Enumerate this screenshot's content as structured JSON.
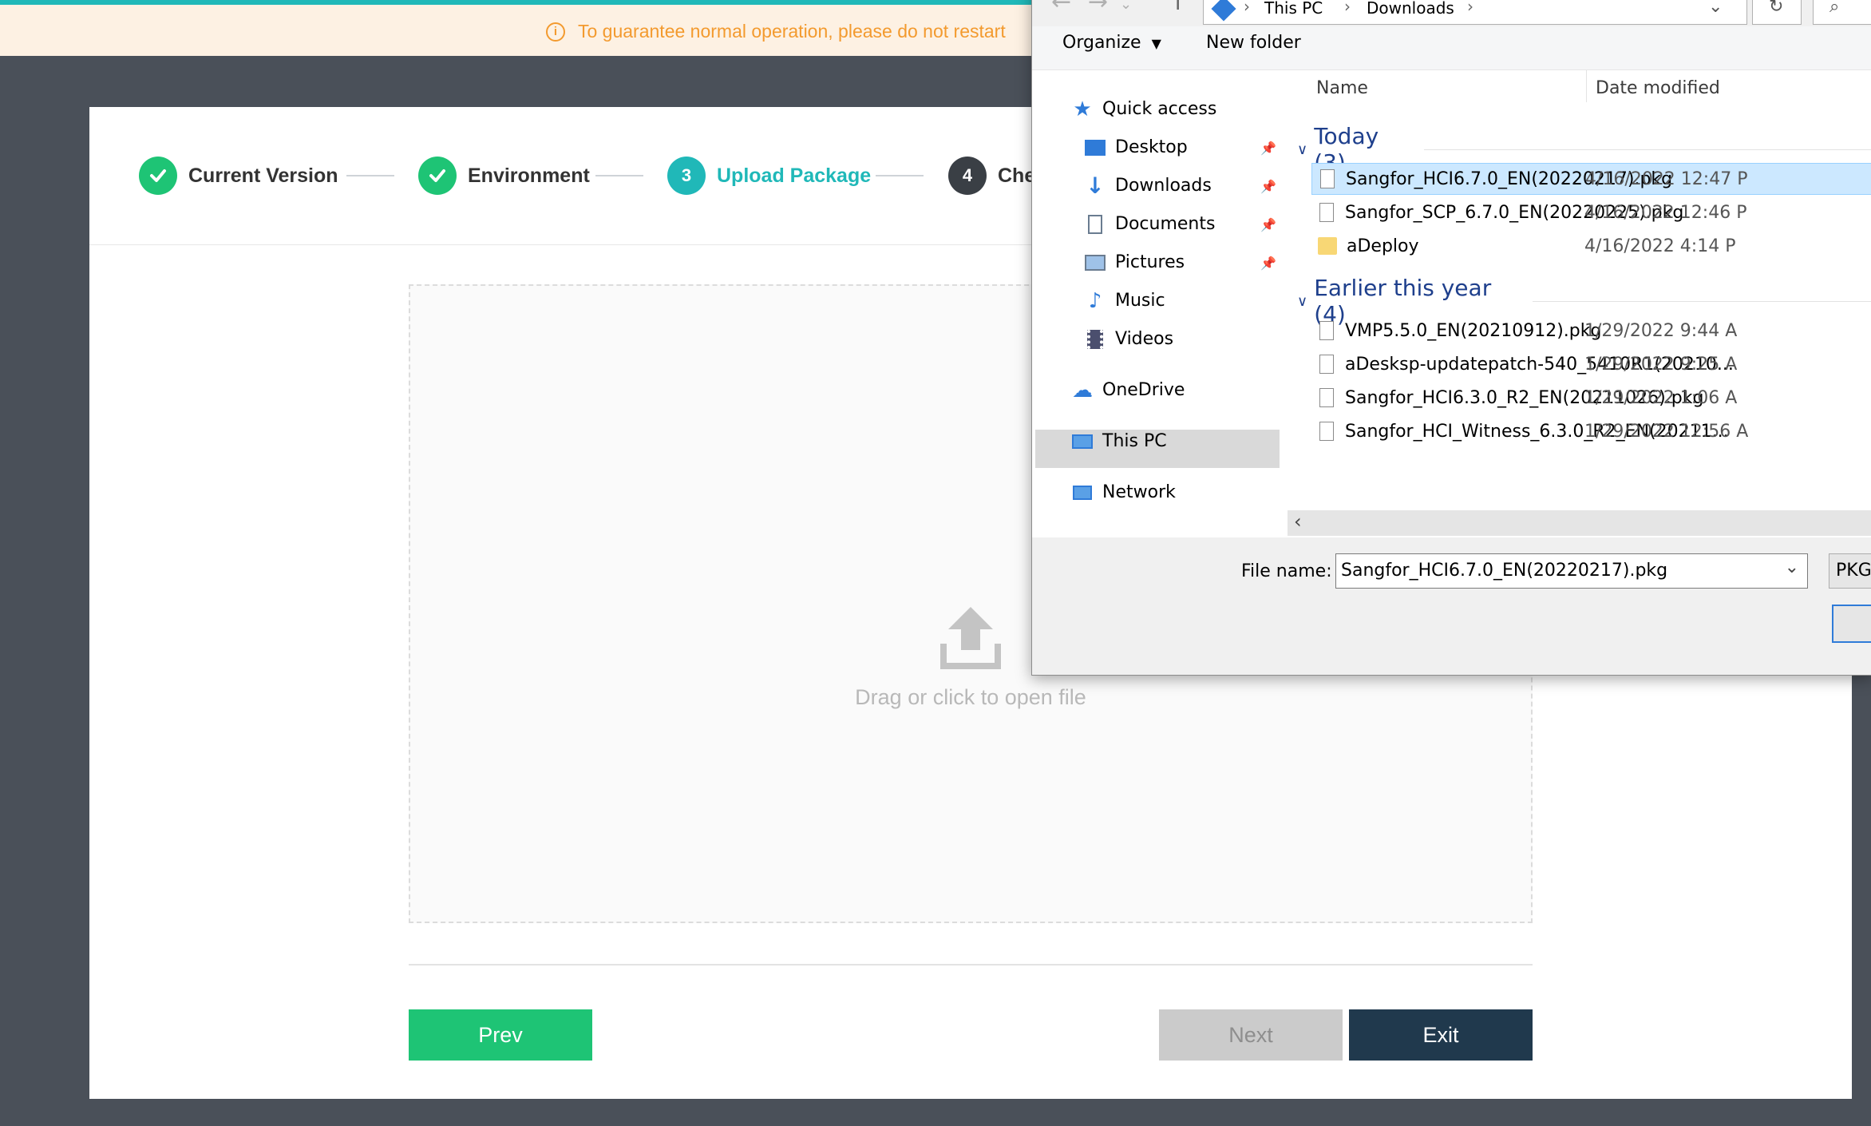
{
  "banner": {
    "text": "To guarantee normal operation, please do not restart"
  },
  "steps": [
    {
      "label": "Current Version",
      "marker": "✓",
      "state": "done"
    },
    {
      "label": "Environment",
      "marker": "✓",
      "state": "done"
    },
    {
      "label": "Upload Package",
      "marker": "3",
      "state": "active"
    },
    {
      "label": "Che",
      "marker": "4",
      "state": "pending"
    }
  ],
  "upload": {
    "hint": "Drag or click to open file"
  },
  "buttons": {
    "prev": "Prev",
    "next": "Next",
    "exit": "Exit"
  },
  "dialog": {
    "breadcrumb": [
      "This PC",
      "Downloads"
    ],
    "toolbar": {
      "organize": "Organize",
      "new_folder": "New folder"
    },
    "nav": {
      "quick_access": "Quick access",
      "desktop": "Desktop",
      "downloads": "Downloads",
      "documents": "Documents",
      "pictures": "Pictures",
      "music": "Music",
      "videos": "Videos",
      "onedrive": "OneDrive",
      "this_pc": "This PC",
      "network": "Network"
    },
    "columns": {
      "name": "Name",
      "date": "Date modified"
    },
    "groups": [
      {
        "label": "Today (3)",
        "files": [
          {
            "name": "Sangfor_HCI6.7.0_EN(20220217).pkg",
            "date": "4/16/2022 12:47 P",
            "kind": "file",
            "selected": true
          },
          {
            "name": "Sangfor_SCP_6.7.0_EN(20220225).pkg",
            "date": "4/16/2022 12:46 P",
            "kind": "file",
            "selected": false
          },
          {
            "name": "aDeploy",
            "date": "4/16/2022 4:14 P",
            "kind": "folder",
            "selected": false
          }
        ]
      },
      {
        "label": "Earlier this year (4)",
        "files": [
          {
            "name": "VMP5.5.0_EN(20210912).pkg",
            "date": "1/29/2022 9:44 A",
            "kind": "file",
            "selected": false
          },
          {
            "name": "aDesksp-updatepatch-540_5410R1(20210...",
            "date": "1/29/2022 9:25 A",
            "kind": "file",
            "selected": false
          },
          {
            "name": "Sangfor_HCI6.3.0_R2_EN(20211026).pkg",
            "date": "1/29/2022 1:06 A",
            "kind": "file",
            "selected": false
          },
          {
            "name": "Sangfor_HCI_Witness_6.3.0_R2_EN(20211...",
            "date": "1/29/2022 12:56 A",
            "kind": "file",
            "selected": false
          }
        ]
      }
    ],
    "filename_label": "File name:",
    "filename_value": "Sangfor_HCI6.7.0_EN(20220217).pkg",
    "filetype": "PKG"
  },
  "colors": {
    "teal": "#20b8b8",
    "green": "#1ec475",
    "navy": "#20394d",
    "orange": "#f39a2e"
  }
}
